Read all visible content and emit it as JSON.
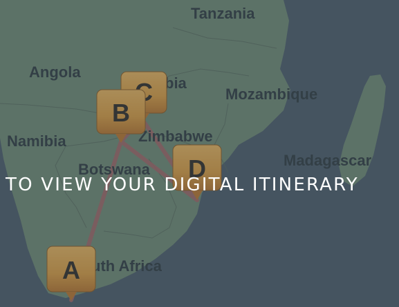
{
  "map": {
    "countries": [
      {
        "key": "tanzania",
        "label": "Tanzania"
      },
      {
        "key": "angola",
        "label": "Angola"
      },
      {
        "key": "zambia",
        "label": "bia"
      },
      {
        "key": "mozambique",
        "label": "Mozambique"
      },
      {
        "key": "namibia",
        "label": "Namibia"
      },
      {
        "key": "zimbabwe",
        "label": "Zimbabwe"
      },
      {
        "key": "botswana",
        "label": "Botswana"
      },
      {
        "key": "madagascar",
        "label": "Madagascar"
      },
      {
        "key": "south_africa",
        "label": "uth Africa"
      }
    ],
    "markers": [
      {
        "key": "a",
        "letter": "A"
      },
      {
        "key": "b",
        "letter": "B"
      },
      {
        "key": "c",
        "letter": "C"
      },
      {
        "key": "d",
        "letter": "D"
      }
    ],
    "colors": {
      "land": "#6f8a74",
      "water": "#4a5a66",
      "route": "#b26a6a",
      "marker": "#d89a3e",
      "marker_bottom": "#b8742a",
      "country_text": "#2f3b3f"
    }
  },
  "overlay": {
    "caption": "TO VIEW YOUR DIGITAL ITINERARY"
  }
}
